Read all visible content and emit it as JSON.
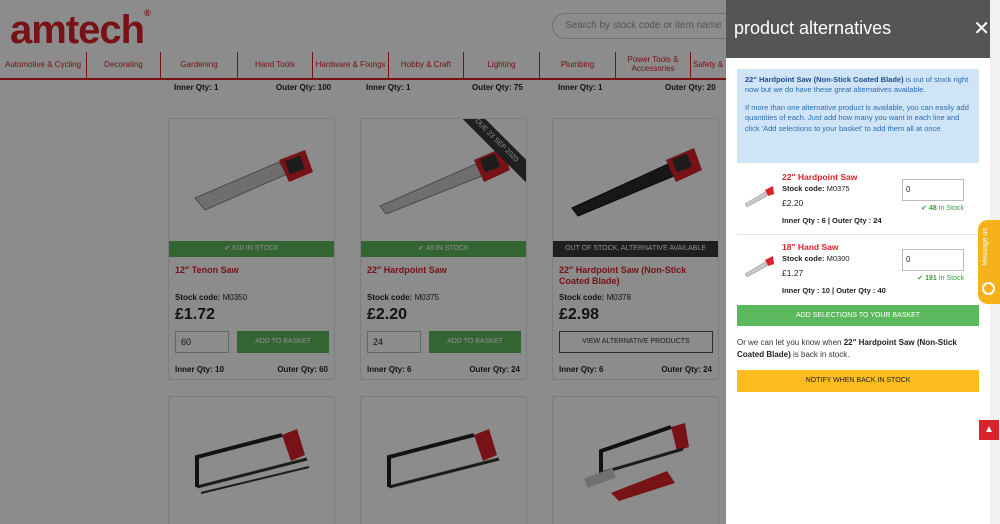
{
  "brand": {
    "logo_text": "amtech",
    "logo_mark": "®"
  },
  "search": {
    "placeholder": "Search by stock code or item name"
  },
  "nav": {
    "items": [
      "Automotive & Cycling",
      "Decorating",
      "Gardening",
      "Hand Tools",
      "Hardware & Fixings",
      "Hobby & Craft",
      "Lighting",
      "Plumbing",
      "Power Tools & Accessories",
      "Safety &"
    ]
  },
  "top_row": [
    {
      "inner": "Inner Qty: 1",
      "outer": "Outer Qty: 100"
    },
    {
      "inner": "Inner Qty: 1",
      "outer": "Outer Qty: 75"
    },
    {
      "inner": "Inner Qty: 1",
      "outer": "Outer Qty: 20"
    }
  ],
  "products": [
    {
      "stock_label": "✔ 610 IN STOCK",
      "name": "12\" Tenon Saw",
      "code_label": "Stock code:",
      "code": "M0350",
      "price": "£1.72",
      "qty": "60",
      "button": "ADD TO BASKET",
      "inner": "Inner Qty: 10",
      "outer": "Outer Qty: 60"
    },
    {
      "stock_label": "✔ 48 IN STOCK",
      "name": "22\" Hardpoint Saw",
      "code_label": "Stock code:",
      "code": "M0375",
      "price": "£2.20",
      "qty": "24",
      "button": "ADD TO BASKET",
      "inner": "Inner Qty: 6",
      "outer": "Outer Qty: 24",
      "ribbon": "DUE 23 SEP 2020"
    },
    {
      "stock_label": "OUT OF STOCK, ALTERNATIVE AVAILABLE",
      "name": "22\" Hardpoint Saw (Non-Stick Coated Blade)",
      "code_label": "Stock code:",
      "code": "M0378",
      "price": "£2.98",
      "button": "VIEW ALTERNATIVE PRODUCTS",
      "inner": "Inner Qty: 6",
      "outer": "Outer Qty: 24"
    }
  ],
  "panel": {
    "title": "product alternatives",
    "info_product": "22\" Hardpoint Saw (Non-Stick Coated Blade)",
    "info_text1": " is out of stock right now but we do have these great alternatives available.",
    "info_text2": "If more than one alternative product is available, you can easily add quantities of each. Just add how many you want in each line and click 'Add selections to your basket' to add them all at once.",
    "alternatives": [
      {
        "name": "22\" Hardpoint Saw",
        "code_label": "Stock code:",
        "code": "M0375",
        "price": "£2.20",
        "qty_text": "Inner Qty : 6 | Outer Qty : 24",
        "qty_value": "0",
        "stock_count": "48",
        "stock_text": " In Stock"
      },
      {
        "name": "18\" Hand Saw",
        "code_label": "Stock code:",
        "code": "M0300",
        "price": "£1.27",
        "qty_text": "Inner Qty : 10 | Outer Qty : 40",
        "qty_value": "0",
        "stock_count": "191",
        "stock_text": " In Stock"
      }
    ],
    "add_selections": "ADD SELECTIONS TO YOUR BASKET",
    "notify_pre": "Or we can let you know when ",
    "notify_product": "22\" Hardpoint Saw (Non-Stick Coated Blade)",
    "notify_post": " is back in stock.",
    "notify_button": "NOTIFY WHEN BACK IN STOCK"
  },
  "widgets": {
    "message_us": "Message us",
    "back_to_top": "▲"
  },
  "colors": {
    "brand_red": "#d9222a",
    "stock_green": "#5cb85c",
    "notify_yellow": "#fbbd1e",
    "info_blue": "#cfe4f7",
    "panel_header": "#555555"
  }
}
